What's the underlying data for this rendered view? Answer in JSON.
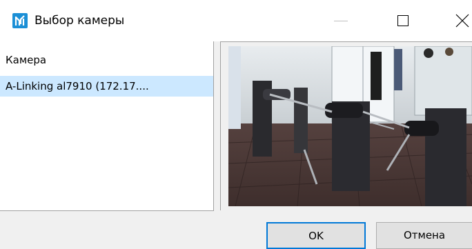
{
  "window": {
    "title": "Выбор камеры",
    "icon": "app-logo-icon",
    "controls": [
      "minimize-icon",
      "maximize-icon",
      "close-icon"
    ]
  },
  "camera_list": {
    "header": "Камера",
    "items": [
      {
        "label": "A-Linking al7910 (172.17....",
        "selected": true
      }
    ]
  },
  "preview": {
    "description_icon": "camera-preview-image"
  },
  "buttons": {
    "ok": "OK",
    "cancel": "Отмена"
  },
  "colors": {
    "selection": "#cce8ff",
    "accent": "#0078d7",
    "app_icon": "#1b8fd6"
  }
}
